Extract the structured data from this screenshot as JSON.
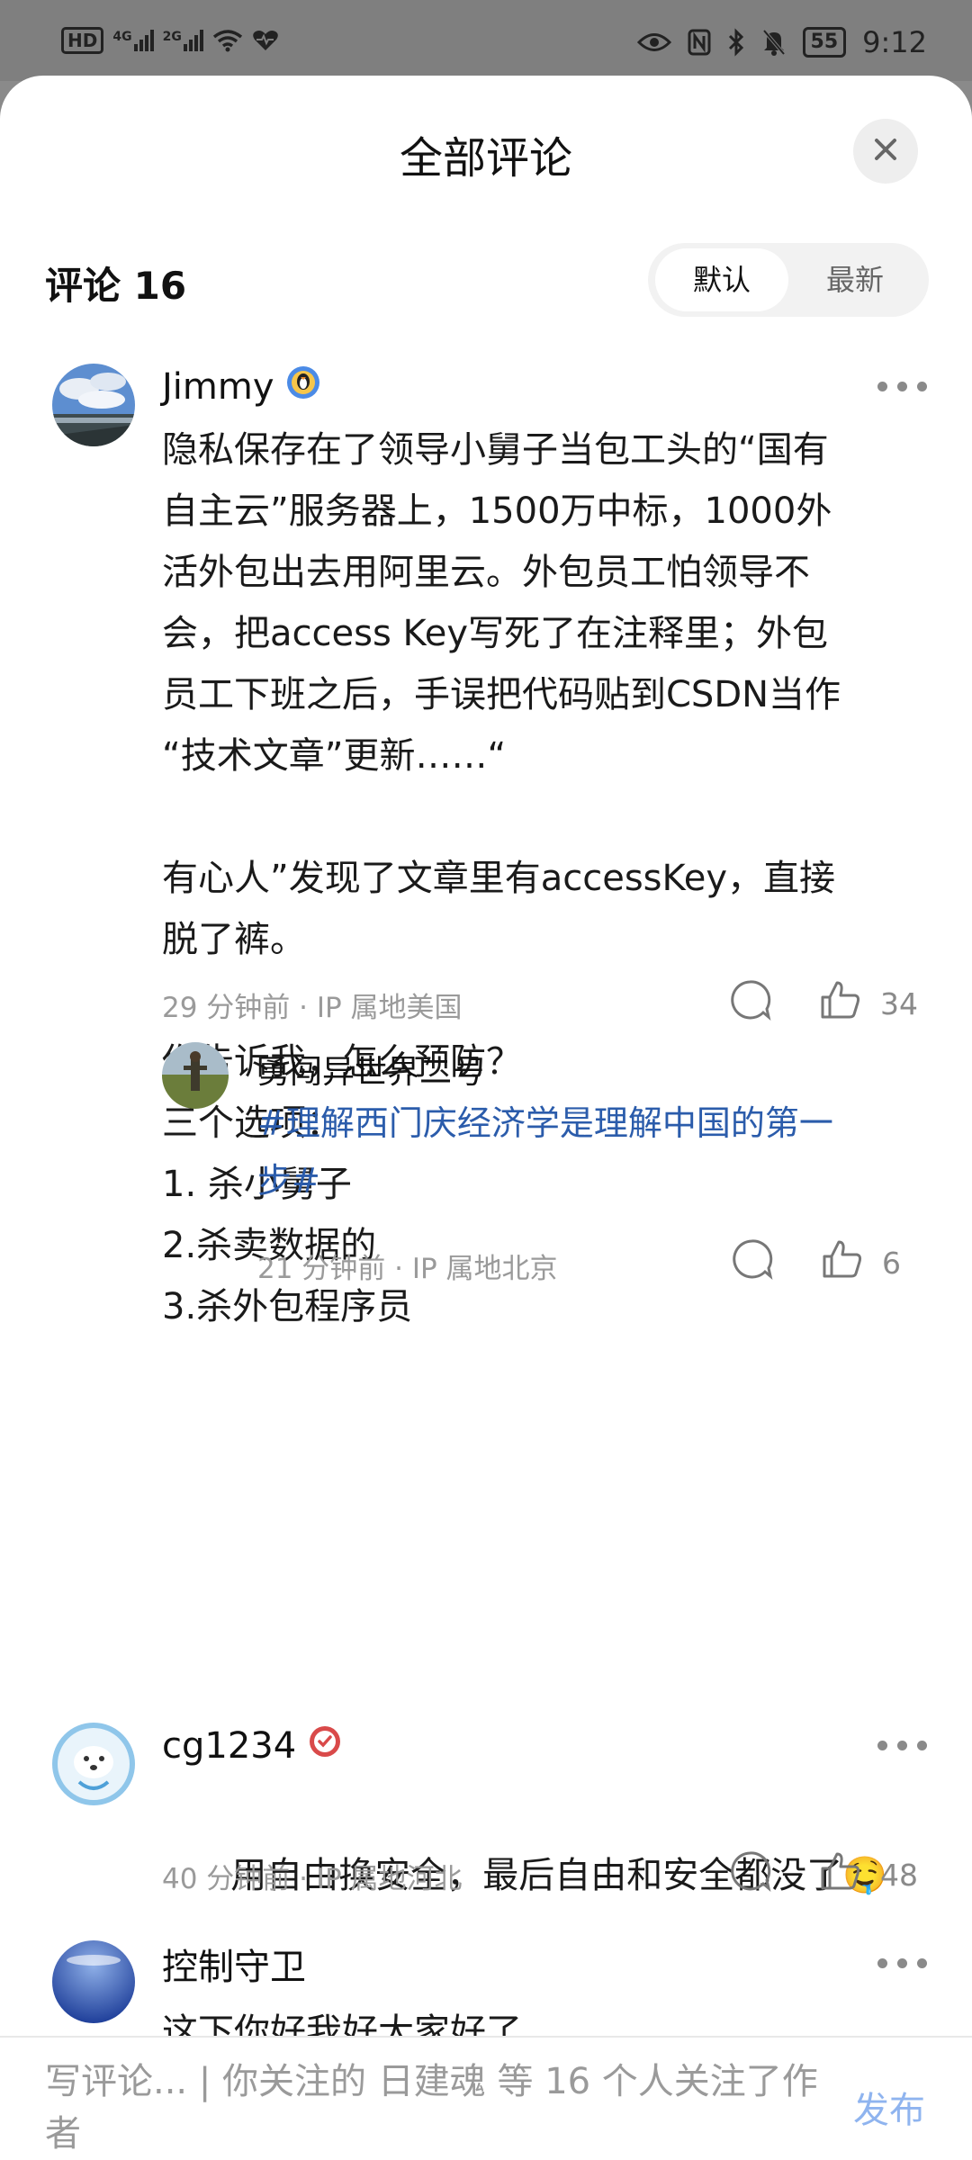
{
  "status_bar": {
    "left_icons": [
      "hd-icon",
      "4g-signal-icon",
      "2g-signal-icon",
      "wifi-icon",
      "health-icon"
    ],
    "signal_1": "4G",
    "signal_2": "2G",
    "hd": "HD",
    "battery": "55",
    "time": "9:12"
  },
  "sheet": {
    "title": "全部评论",
    "count_label": "评论 16",
    "sort_options": [
      "默认",
      "最新"
    ],
    "sort_selected": "默认"
  },
  "comments": [
    {
      "user": "Jimmy",
      "badge": "penguin-badge-icon",
      "text": "隐私保存在了领导小舅子当包工头的“国有\n自主云”服务器上，1500万中标，1000外\n活外包出去用阿里云。外包员工怕领导不\n会，把access Key写死了在注释里；外包\n员工下班之后，手误把代码贴到CSDN当作\n“技术文章”更新……“\n\n有心人”发现了文章里有accessKey，直接\n脱了裤。\n\n你告诉我，怎么预防？\n三个选项：\n1. 杀小舅子\n2.杀卖数据的\n3.杀外包程序员",
      "meta": "29 分钟前 · IP 属地美国",
      "likes": "34",
      "reply": {
        "user": "勇闯异世界二号",
        "text": "#理解西门庆经济学是理解中国的第一\n步#",
        "meta": "21 分钟前 · IP 属地北京",
        "likes": "6"
      }
    },
    {
      "user": "cg1234",
      "badge": "verified-badge-icon",
      "text": "用自由换安全，最后自由和安全都没了",
      "emoji": "🤤",
      "meta": "40 分钟前 · IP 属地河北",
      "likes": "48"
    },
    {
      "user": "控制守卫",
      "text": "这下你好我好大家好了"
    }
  ],
  "bottom_bar": {
    "placeholder": "写评论... | 你关注的 日建魂 等 16 个人关注了作者",
    "publish": "发布"
  },
  "colors": {
    "accent_link": "#2b5cab",
    "publish_disabled": "#8fb4ef",
    "meta_gray": "#9a9a9a"
  }
}
